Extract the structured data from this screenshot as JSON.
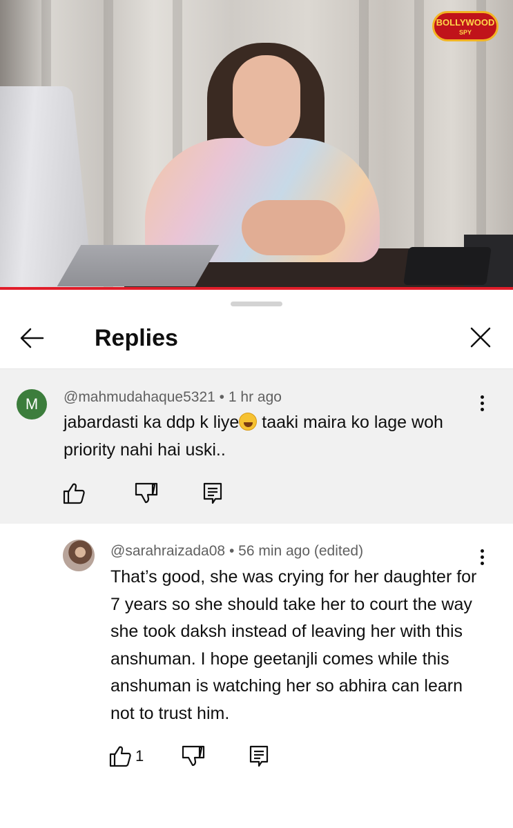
{
  "video": {
    "channel_logo_text": "BOLLYWOOD",
    "channel_logo_sub": "SPY"
  },
  "header": {
    "title": "Replies",
    "back_icon": "arrow-left-icon",
    "close_icon": "close-icon"
  },
  "parent_comment": {
    "avatar_letter": "M",
    "avatar_color": "#3c7d3c",
    "author": "@mahmudahaque5321",
    "separator": "•",
    "time": "1 hr ago",
    "text_before_emoji": "jabardasti ka ddp k liye",
    "emoji": "rolling-on-the-floor-laughing-emoji",
    "text_after_emoji": " taaki maira ko lage woh priority nahi hai uski.."
  },
  "reply": {
    "author": "@sarahraizada08",
    "separator": "•",
    "time": "56 min ago (edited)",
    "text": "That’s good, she was crying for her daughter for 7 years so she should take her to court the way she took daksh instead of leaving her with this anshuman. I hope geetanjli comes while this anshuman is watching her so abhira can learn not to trust him.",
    "like_count": "1"
  },
  "colors": {
    "progress_bar": "#e11d2a",
    "parent_background": "#f1f1f1",
    "meta_text": "#606060"
  }
}
